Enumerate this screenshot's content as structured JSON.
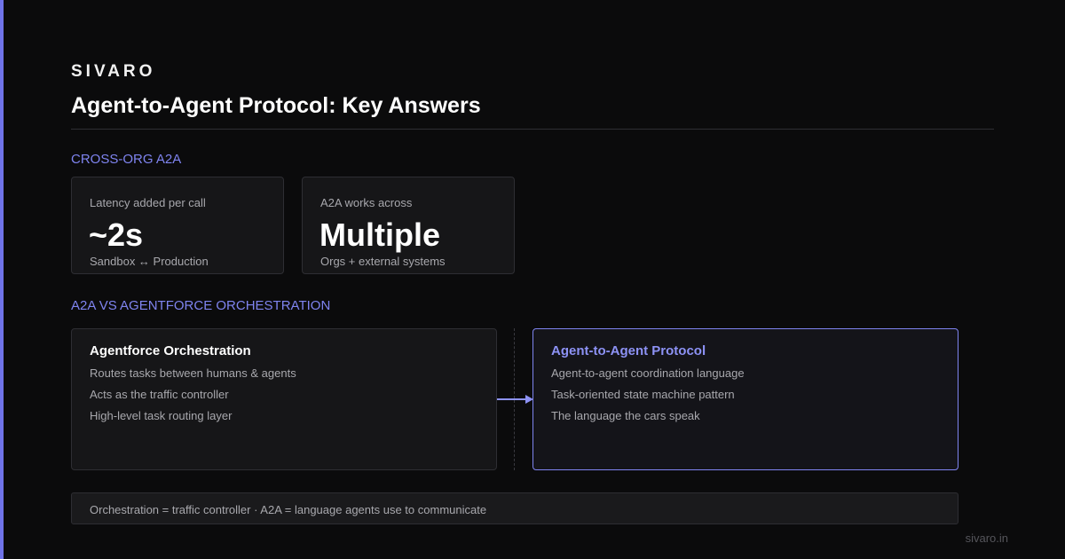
{
  "brand": "SIVARO",
  "title": "Agent-to-Agent Protocol: Key Answers",
  "colors": {
    "accent": "#6f73e8",
    "background": "#0b0b0c",
    "label": "#7f84f0"
  },
  "cross_org": {
    "label": "CROSS-ORG A2A",
    "cards": [
      {
        "caption": "Latency added per call",
        "value": "~2s",
        "sub": "Sandbox ↔ Production"
      },
      {
        "caption": "A2A works across",
        "value": "Multiple",
        "sub": "Orgs + external systems"
      }
    ]
  },
  "comparison": {
    "label": "A2A VS AGENTFORCE ORCHESTRATION",
    "left": {
      "title": "Agentforce Orchestration",
      "items": [
        "Routes tasks between humans & agents",
        "Acts as the traffic controller",
        "High-level task routing layer"
      ]
    },
    "right": {
      "title": "Agent-to-Agent Protocol",
      "items": [
        "Agent-to-agent coordination language",
        "Task-oriented state machine pattern",
        "The language the cars speak"
      ]
    }
  },
  "footer": "Orchestration = traffic controller · A2A = language agents use to communicate",
  "site": "sivaro.in"
}
